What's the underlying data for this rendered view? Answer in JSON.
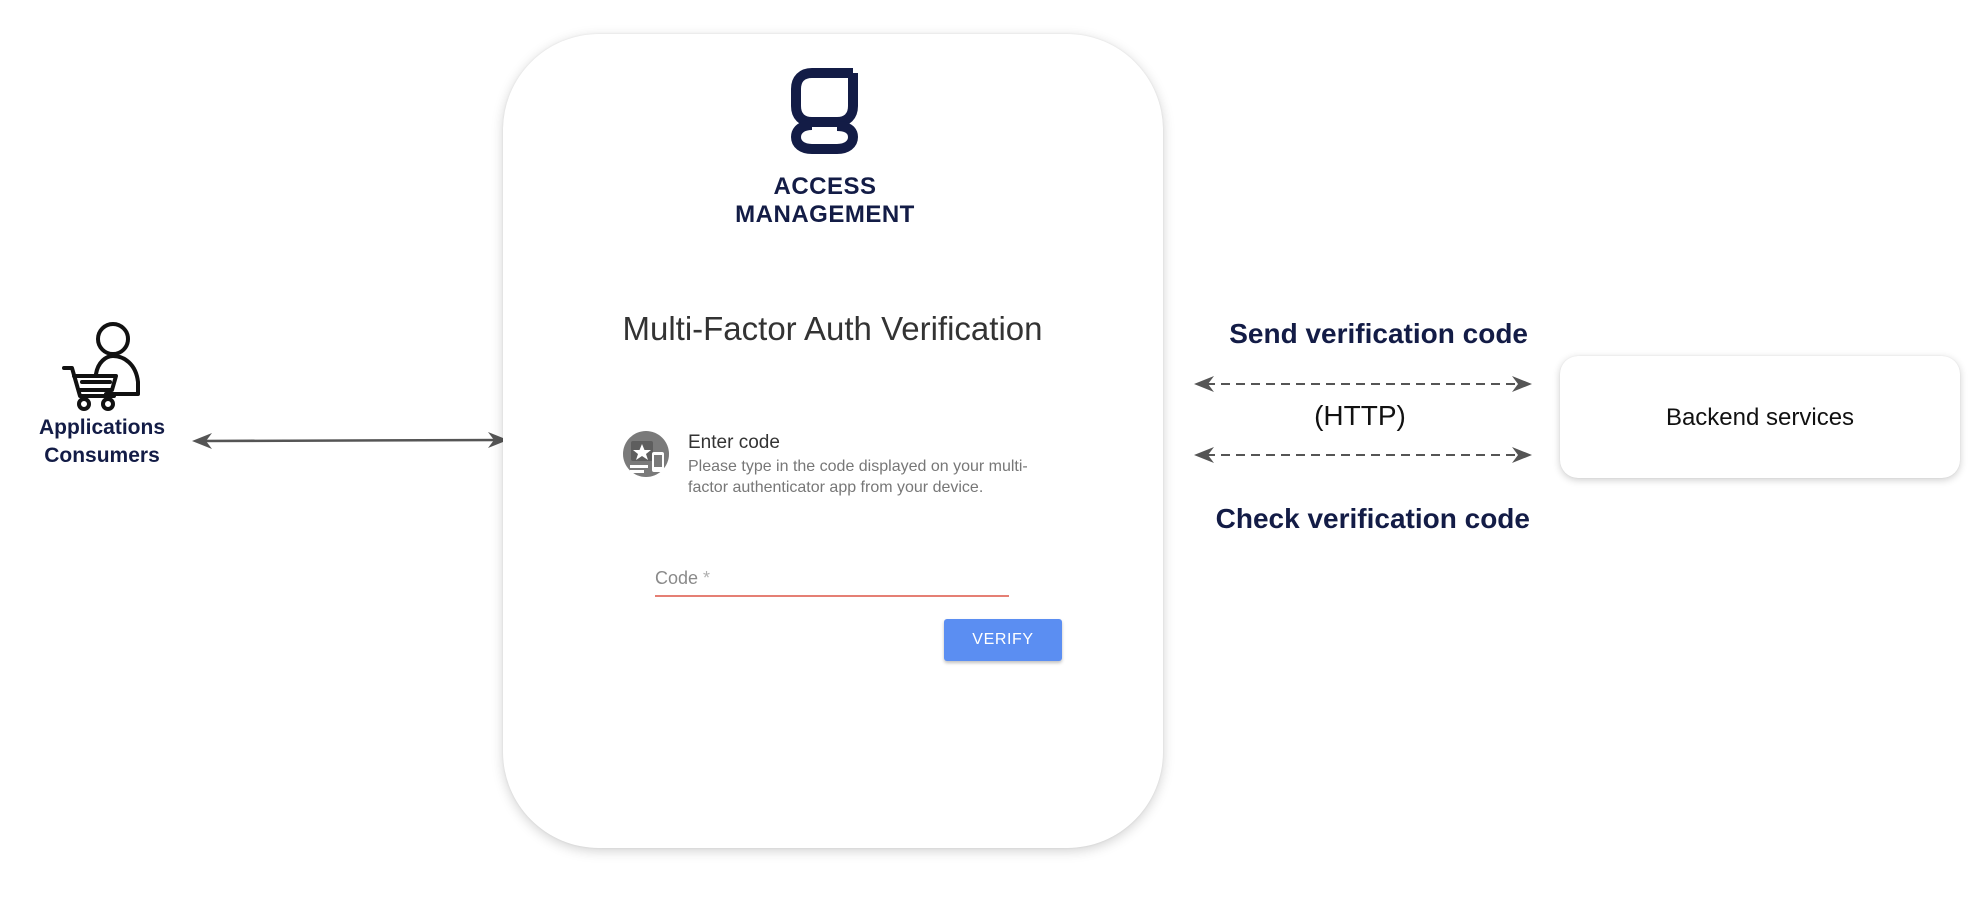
{
  "consumer": {
    "icon": "shopper-cart-icon",
    "label_line1": "Applications",
    "label_line2": "Consumers"
  },
  "brand": {
    "logo_icon": "gravitee-g-logo-icon",
    "line1": "ACCESS",
    "line2": "MANAGEMENT",
    "color": "#131c46"
  },
  "mfa_form": {
    "title": "Multi-Factor Auth Verification",
    "factor_icon": "authenticator-app-icon",
    "enter_code_title": "Enter code",
    "enter_code_description": "Please type in the code displayed on your multi-factor authenticator app from your device.",
    "code_input_label": "Code",
    "code_required_marker": "*",
    "verify_button_label": "VERIFY",
    "button_color": "#5b8ef2",
    "underline_color": "#e57f74"
  },
  "connections": {
    "send_label": "Send verification code",
    "protocol_label": "(HTTP)",
    "check_label": "Check verification code"
  },
  "backend": {
    "label": "Backend services"
  }
}
